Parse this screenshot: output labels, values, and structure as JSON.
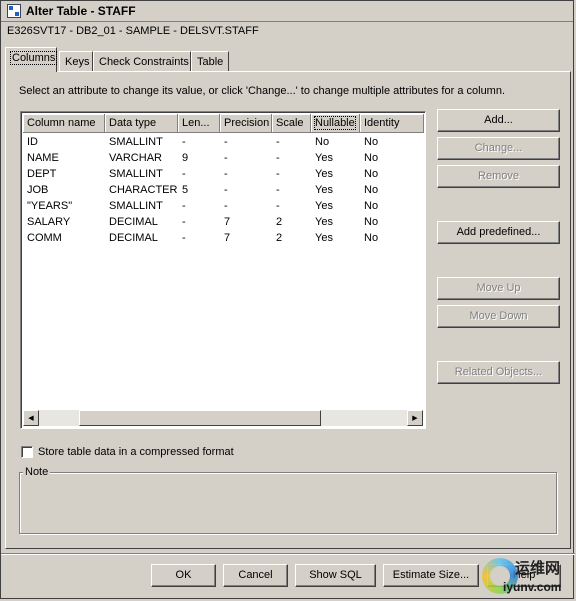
{
  "window": {
    "title": "Alter Table - STAFF",
    "subtitle": "E326SVT17 - DB2_01 - SAMPLE - DELSVT.STAFF"
  },
  "tabs": [
    {
      "label": "Columns",
      "active": true
    },
    {
      "label": "Keys"
    },
    {
      "label": "Check Constraints"
    },
    {
      "label": "Table"
    }
  ],
  "instruction": "Select an attribute to change its value, or click 'Change...' to change multiple attributes for a column.",
  "grid": {
    "columns": [
      "Column name",
      "Data type",
      "Len...",
      "Precision",
      "Scale",
      "Nullable",
      "Identity"
    ],
    "rows": [
      [
        "ID",
        "SMALLINT",
        "-",
        "-",
        "-",
        "No",
        "No"
      ],
      [
        "NAME",
        "VARCHAR",
        "9",
        "-",
        "-",
        "Yes",
        "No"
      ],
      [
        "DEPT",
        "SMALLINT",
        "-",
        "-",
        "-",
        "Yes",
        "No"
      ],
      [
        "JOB",
        "CHARACTER",
        "5",
        "-",
        "-",
        "Yes",
        "No"
      ],
      [
        "\"YEARS\"",
        "SMALLINT",
        "-",
        "-",
        "-",
        "Yes",
        "No"
      ],
      [
        "SALARY",
        "DECIMAL",
        "-",
        "7",
        "2",
        "Yes",
        "No"
      ],
      [
        "COMM",
        "DECIMAL",
        "-",
        "7",
        "2",
        "Yes",
        "No"
      ]
    ]
  },
  "side_buttons": {
    "add": "Add...",
    "change": "Change...",
    "remove": "Remove",
    "add_predefined": "Add predefined...",
    "move_up": "Move Up",
    "move_down": "Move Down",
    "related_objects": "Related Objects..."
  },
  "compress_checkbox": {
    "label": "Store table data in a compressed format",
    "checked": false
  },
  "note_label": "Note",
  "footer_buttons": {
    "ok": "OK",
    "cancel": "Cancel",
    "show_sql": "Show SQL",
    "estimate_size": "Estimate Size...",
    "help": "Help"
  },
  "watermark": {
    "chinese": "运维网",
    "url": "iyunv.com"
  }
}
